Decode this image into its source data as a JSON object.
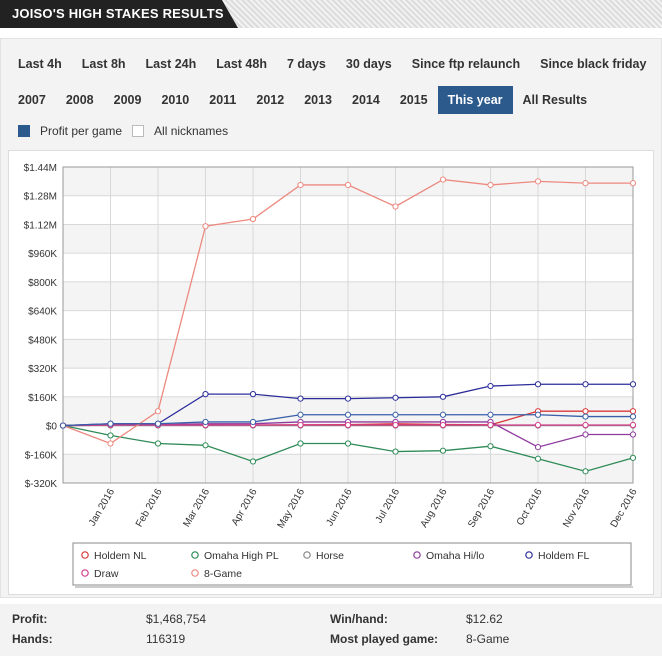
{
  "header": {
    "title": "JOISO'S HIGH STAKES RESULTS"
  },
  "filters": {
    "periods": [
      "Last 4h",
      "Last 8h",
      "Last 24h",
      "Last 48h",
      "7 days",
      "30 days",
      "Since ftp relaunch",
      "Since black friday"
    ],
    "years": [
      "2007",
      "2008",
      "2009",
      "2010",
      "2011",
      "2012",
      "2013",
      "2014",
      "2015",
      "This year",
      "All Results"
    ],
    "active_year": "This year"
  },
  "modes": {
    "profit_per_game": "Profit per game",
    "all_nicknames": "All nicknames"
  },
  "chart_data": {
    "type": "line",
    "x": [
      "",
      "Jan 2016",
      "Feb 2016",
      "Mar 2016",
      "Apr 2016",
      "May 2016",
      "Jun 2016",
      "Jul 2016",
      "Aug 2016",
      "Sep 2016",
      "Oct 2016",
      "Nov 2016",
      "Dec 2016"
    ],
    "ylim": [
      -320000,
      1440000
    ],
    "yticks": [
      {
        "v": 1440000,
        "label": "$1.44M"
      },
      {
        "v": 1280000,
        "label": "$1.28M"
      },
      {
        "v": 1120000,
        "label": "$1.12M"
      },
      {
        "v": 960000,
        "label": "$960K"
      },
      {
        "v": 800000,
        "label": "$800K"
      },
      {
        "v": 640000,
        "label": "$640K"
      },
      {
        "v": 480000,
        "label": "$480K"
      },
      {
        "v": 320000,
        "label": "$320K"
      },
      {
        "v": 160000,
        "label": "$160K"
      },
      {
        "v": 0,
        "label": "$0"
      },
      {
        "v": -160000,
        "label": "$-160K"
      },
      {
        "v": -320000,
        "label": "$-320K"
      }
    ],
    "grid": true,
    "legend_position": "bottom",
    "series": [
      {
        "name": "Holdem NL",
        "color": "#d9383a",
        "values": [
          0,
          2000,
          3000,
          5000,
          3000,
          4000,
          5000,
          10000,
          6000,
          4000,
          80000,
          80000,
          80000
        ]
      },
      {
        "name": "Omaha High PL",
        "color": "#2e8b57",
        "values": [
          0,
          -55000,
          -100000,
          -110000,
          -200000,
          -100000,
          -100000,
          -145000,
          -140000,
          -115000,
          -185000,
          -255000,
          -180000
        ]
      },
      {
        "name": "Horse",
        "color": "#888888",
        "values": [
          0,
          0,
          0,
          0,
          0,
          0,
          0,
          0,
          0,
          0,
          0,
          0,
          0
        ]
      },
      {
        "name": "Omaha Hi/lo",
        "color": "#8e3a9d",
        "values": [
          0,
          5000,
          5000,
          10000,
          10000,
          20000,
          20000,
          20000,
          20000,
          20000,
          -120000,
          -50000,
          -50000
        ]
      },
      {
        "name": "Holdem FL",
        "color": "#2b2e9a",
        "values": [
          0,
          10000,
          10000,
          175000,
          175000,
          150000,
          150000,
          155000,
          160000,
          220000,
          230000,
          230000,
          230000
        ]
      },
      {
        "name": "Draw",
        "color": "#d63c8a",
        "values": [
          0,
          3000,
          3000,
          3000,
          3000,
          3000,
          3000,
          3000,
          3000,
          3000,
          3000,
          3000,
          3000
        ]
      },
      {
        "name": "8-Game",
        "color": "#ec8a80",
        "values": [
          0,
          -100000,
          80000,
          1110000,
          1150000,
          1340000,
          1340000,
          1220000,
          1370000,
          1340000,
          1360000,
          1350000,
          1350000
        ]
      },
      {
        "name": "",
        "color": "#3a5fa8",
        "values": [
          0,
          10000,
          10000,
          20000,
          20000,
          60000,
          60000,
          60000,
          60000,
          60000,
          60000,
          50000,
          50000
        ]
      }
    ]
  },
  "stats": {
    "profit_label": "Profit:",
    "profit_value": "$1,468,754",
    "hands_label": "Hands:",
    "hands_value": "116319",
    "winhand_label": "Win/hand:",
    "winhand_value": "$12.62",
    "mostplayed_label": "Most played game:",
    "mostplayed_value": "8-Game"
  }
}
